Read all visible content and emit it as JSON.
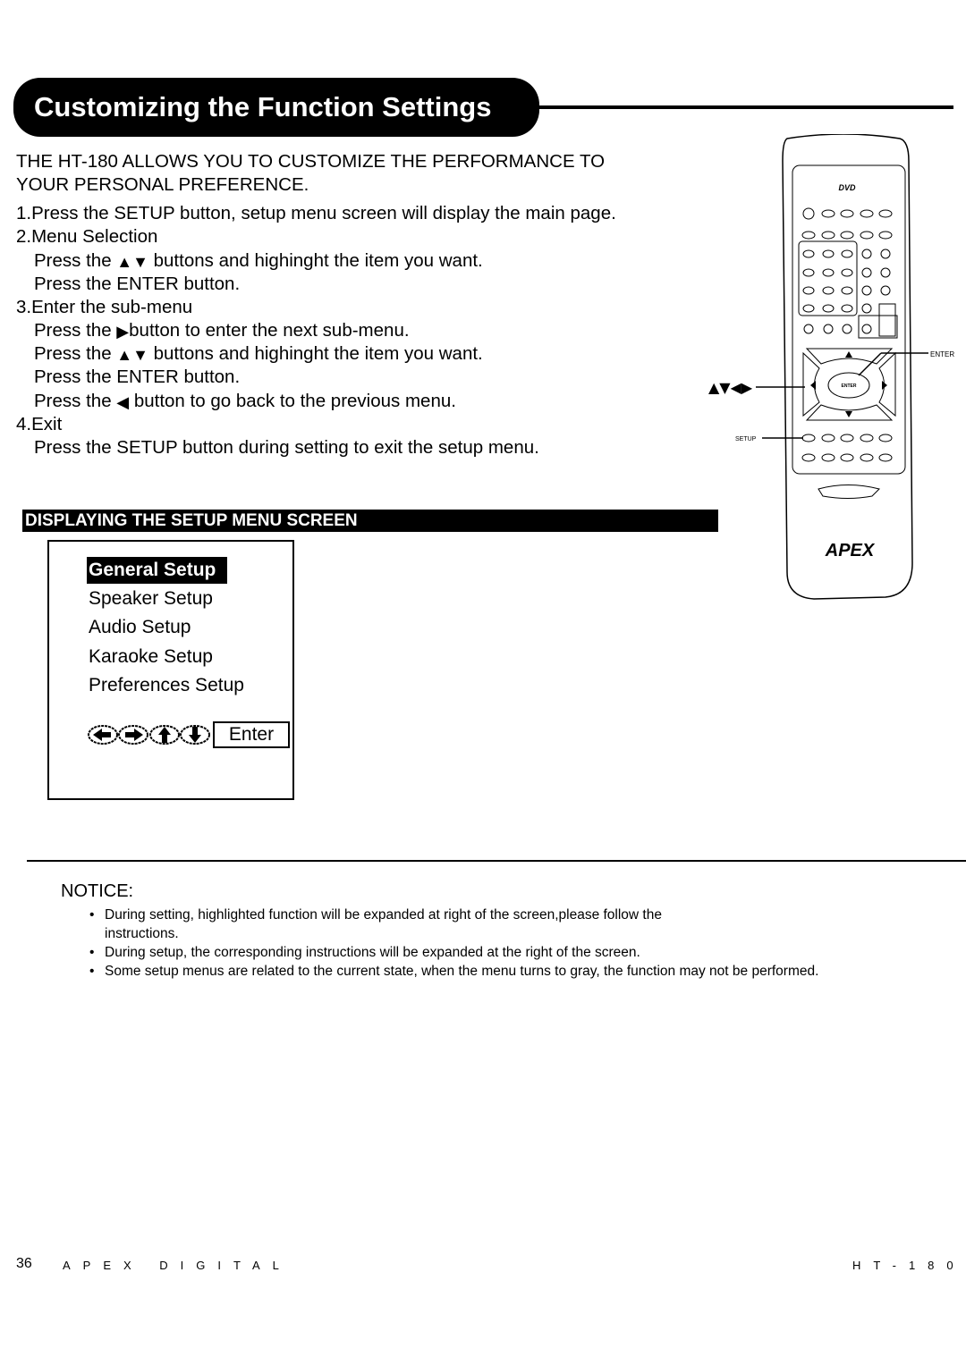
{
  "title": "Customizing the Function Settings",
  "intro": [
    "THE HT-180 ALLOWS YOU TO CUSTOMIZE THE PERFORMANCE TO",
    "YOUR PERSONAL PREFERENCE."
  ],
  "steps": {
    "s1": "1.Press the SETUP button, setup menu screen will display the main page.",
    "s2": "2.Menu Selection",
    "s2a_pre": "Press the ",
    "s2a_post": " buttons and highinght the item you want.",
    "s2b": "Press the ENTER button.",
    "s3": "3.Enter the sub-menu",
    "s3a_pre": "Press the ",
    "s3a_post": "button to enter the next sub-menu.",
    "s3b_pre": "Press the ",
    "s3b_post": " buttons and highinght the item you want.",
    "s3c": "Press the ENTER button.",
    "s3d_pre": "Press the ",
    "s3d_post": " button to go back to the previous menu.",
    "s4": "4.Exit",
    "s4a": "Press the SETUP button during setting to exit the setup menu."
  },
  "icons": {
    "up_down": "▲▼",
    "right": "▶",
    "left": "◀",
    "all": "▲▼◀▶"
  },
  "section_heading": "DISPLAYING THE SETUP MENU SCREEN",
  "menu": {
    "items": [
      "General Setup",
      "Speaker Setup",
      "Audio Setup",
      "Karaoke Setup",
      "Preferences Setup"
    ],
    "selected": 0,
    "enter_label": "Enter"
  },
  "remote": {
    "enter_callout": "ENTER",
    "setup_callout": "SETUP",
    "center_label": "ENTER",
    "brand": "APEX"
  },
  "notice": {
    "heading": "NOTICE:",
    "bullets": [
      "During setting, highlighted function will be expanded at right of the screen,please follow the",
      "instructions.",
      "During setup, the corresponding instructions will be expanded at the right of the screen.",
      "Some setup menus are related to the current state, when the menu turns to gray, the function may not be performed."
    ]
  },
  "footer": {
    "page": "36",
    "brand": "APEX DIGITAL",
    "model": "HT-180"
  }
}
